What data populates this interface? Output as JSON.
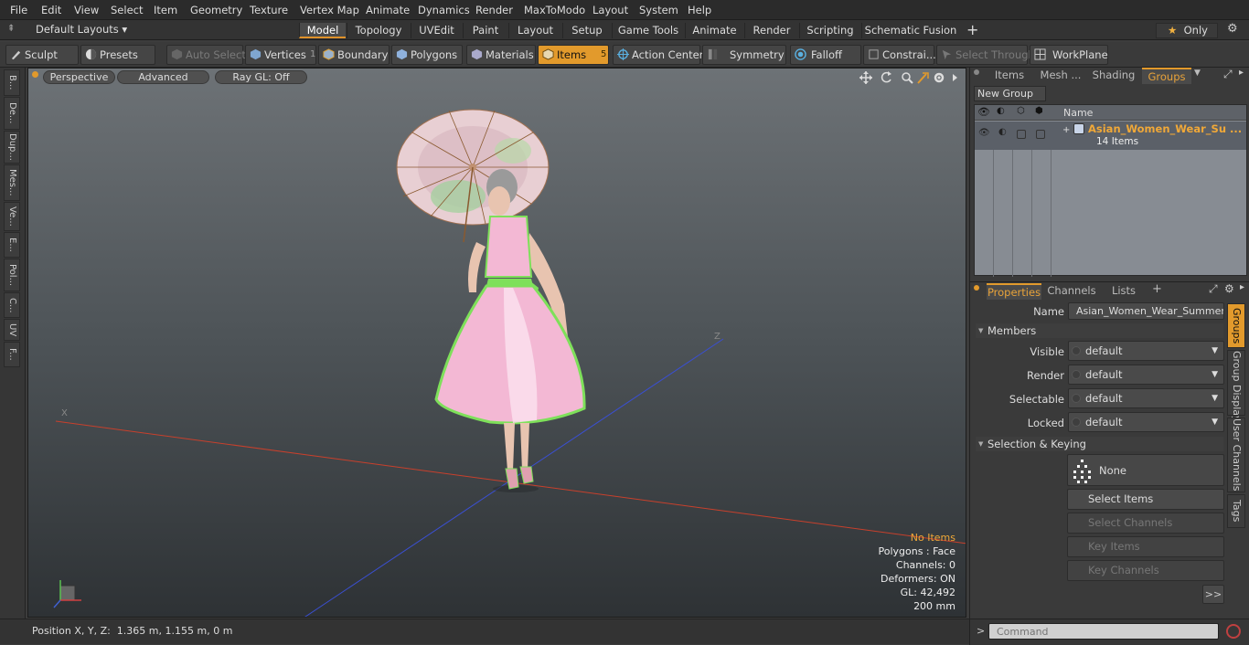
{
  "menu": [
    "File",
    "Edit",
    "View",
    "Select",
    "Item",
    "Geometry",
    "Texture",
    "Vertex Map",
    "Animate",
    "Dynamics",
    "Render",
    "MaxToModo",
    "Layout",
    "System",
    "Help"
  ],
  "layout_selector": "Default Layouts",
  "layout_tabs": [
    "Model",
    "Topology",
    "UVEdit",
    "Paint",
    "Layout",
    "Setup",
    "Game Tools",
    "Animate",
    "Render",
    "Scripting",
    "Schematic Fusion"
  ],
  "active_layout_tab": "Model",
  "only_label": "Only",
  "toolbar": {
    "sculpt": "Sculpt",
    "presets": "Presets",
    "auto_select": "Auto Select",
    "vertices": "Vertices",
    "vertices_count": "1",
    "boundary": "Boundary",
    "polygons": "Polygons",
    "materials": "Materials",
    "items": "Items",
    "items_count": "5",
    "action_center": "Action Center",
    "symmetry": "Symmetry",
    "falloff": "Falloff",
    "constraints": "Constrai...",
    "select_through": "Select Through",
    "workplane": "WorkPlane"
  },
  "left_tabs": [
    "B...",
    "De...",
    "Dup...",
    "Mes...",
    "Ve...",
    "E...",
    "Pol...",
    "C...",
    "UV",
    "F..."
  ],
  "viewport": {
    "view_mode": "Perspective",
    "shading": "Advanced",
    "raygl": "Ray GL: Off",
    "axis_x": "X",
    "axis_z": "Z"
  },
  "stats": {
    "selection": "No Items",
    "polygons": "Polygons : Face",
    "channels": "Channels: 0",
    "deformers": "Deformers: ON",
    "gl": "GL: 42,492",
    "scale": "200 mm"
  },
  "status": {
    "position": "Position X, Y, Z:  1.365 m, 1.155 m, 0 m",
    "command_placeholder": "Command"
  },
  "groups_panel": {
    "tabs": [
      "Items",
      "Mesh ...",
      "Shading",
      "Groups"
    ],
    "active_tab": "Groups",
    "new_group": "New Group",
    "name_col": "Name",
    "group_name": "Asian_Women_Wear_Su ...",
    "group_count": "14 Items"
  },
  "properties_panel": {
    "tabs": [
      "Properties",
      "Channels",
      "Lists"
    ],
    "active_tab": "Properties",
    "name_label": "Name",
    "name_value": "Asian_Women_Wear_Summer_F",
    "members_section": "Members",
    "fields": [
      {
        "label": "Visible",
        "value": "default"
      },
      {
        "label": "Render",
        "value": "default"
      },
      {
        "label": "Selectable",
        "value": "default"
      },
      {
        "label": "Locked",
        "value": "default"
      }
    ],
    "selection_section": "Selection & Keying",
    "none_button": "None",
    "select_items": "Select Items",
    "select_channels": "Select Channels",
    "key_items": "Key Items",
    "key_channels": "Key Channels",
    "more": ">>"
  },
  "side_tabs": [
    "Groups",
    "Group Display",
    "User Channels",
    "Tags"
  ],
  "colors": {
    "accent_orange": "#e29a2c",
    "group_name_orange": "#f0a838",
    "x_axis_red": "#c8402c",
    "z_axis_blue": "#3a4fd0",
    "dress_pink": "#f3b8d4",
    "trim_green": "#7ee05a"
  }
}
